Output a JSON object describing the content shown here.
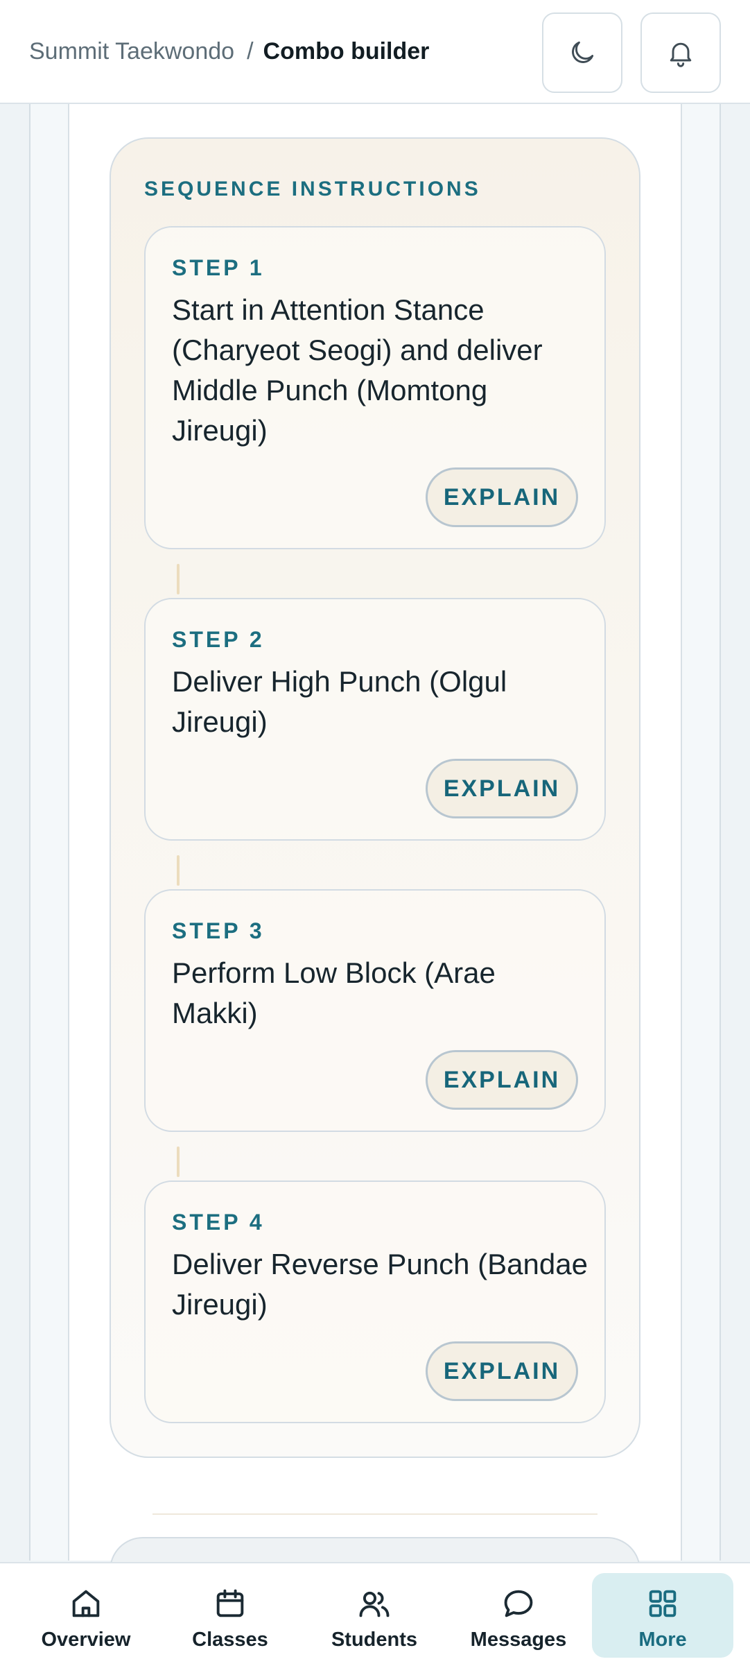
{
  "header": {
    "breadcrumb_parent": "Summit Taekwondo",
    "breadcrumb_separator": "/",
    "breadcrumb_current": "Combo builder",
    "theme_icon": "moon-icon",
    "notification_icon": "bell-icon"
  },
  "sequence": {
    "title": "SEQUENCE INSTRUCTIONS",
    "steps": [
      {
        "label": "STEP 1",
        "text": "Start in Attention Stance (Charyeot Seogi) and deliver Middle Punch (Momtong Jireugi)",
        "button": "EXPLAIN"
      },
      {
        "label": "STEP 2",
        "text": "Deliver High Punch (Olgul Jireugi)",
        "button": "EXPLAIN"
      },
      {
        "label": "STEP 3",
        "text": "Perform Low Block (Arae Makki)",
        "button": "EXPLAIN"
      },
      {
        "label": "STEP 4",
        "text": "Deliver Reverse Punch (Bandae Jireugi)",
        "button": "EXPLAIN"
      }
    ]
  },
  "nav": {
    "items": [
      {
        "label": "Overview",
        "icon": "home-icon",
        "active": false
      },
      {
        "label": "Classes",
        "icon": "calendar-icon",
        "active": false
      },
      {
        "label": "Students",
        "icon": "users-icon",
        "active": false
      },
      {
        "label": "Messages",
        "icon": "chat-icon",
        "active": false
      },
      {
        "label": "More",
        "icon": "grid-icon",
        "active": true
      }
    ]
  },
  "colors": {
    "accent": "#1c6e80",
    "active_nav_bg": "#d9eef1",
    "card_warm": "#f7f2e9"
  }
}
